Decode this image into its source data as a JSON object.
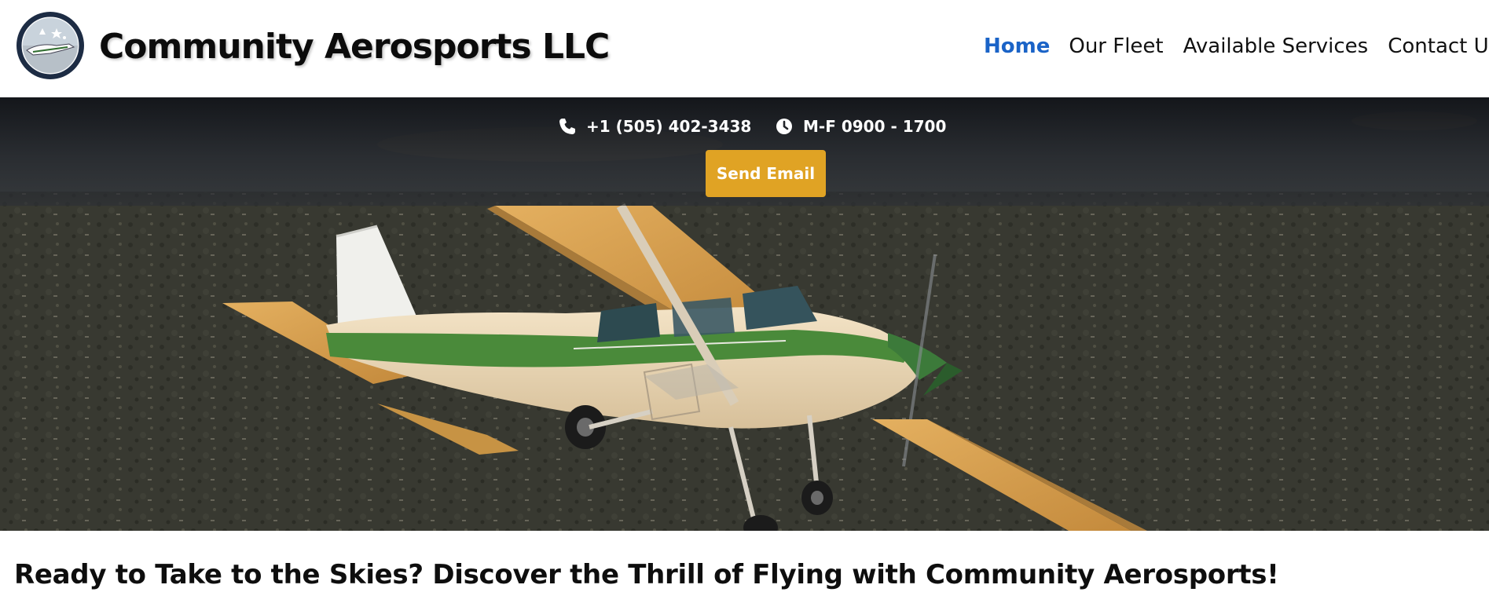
{
  "header": {
    "logo_icon": "community-aerosports-logo",
    "brand_name": "Community Aerosports LLC",
    "nav": [
      {
        "label": "Home",
        "active": true
      },
      {
        "label": "Our Fleet",
        "active": false
      },
      {
        "label": "Available Services",
        "active": false
      },
      {
        "label": "Contact Us",
        "active": false
      }
    ]
  },
  "contact": {
    "phone_icon": "phone-icon",
    "phone": "+1 (505) 402-3438",
    "hours_icon": "clock-icon",
    "hours": "M-F 0900 - 1700",
    "email_button_label": "Send Email"
  },
  "hero": {
    "image_subject": "airplane"
  },
  "main": {
    "headline": "Ready to Take to the Skies? Discover the Thrill of Flying with Community Aerosports!"
  },
  "colors": {
    "nav_active": "#1a63c7",
    "email_button": "#e0a324",
    "band_dark": "#16181c",
    "plane_green": "#4a8a3a"
  }
}
